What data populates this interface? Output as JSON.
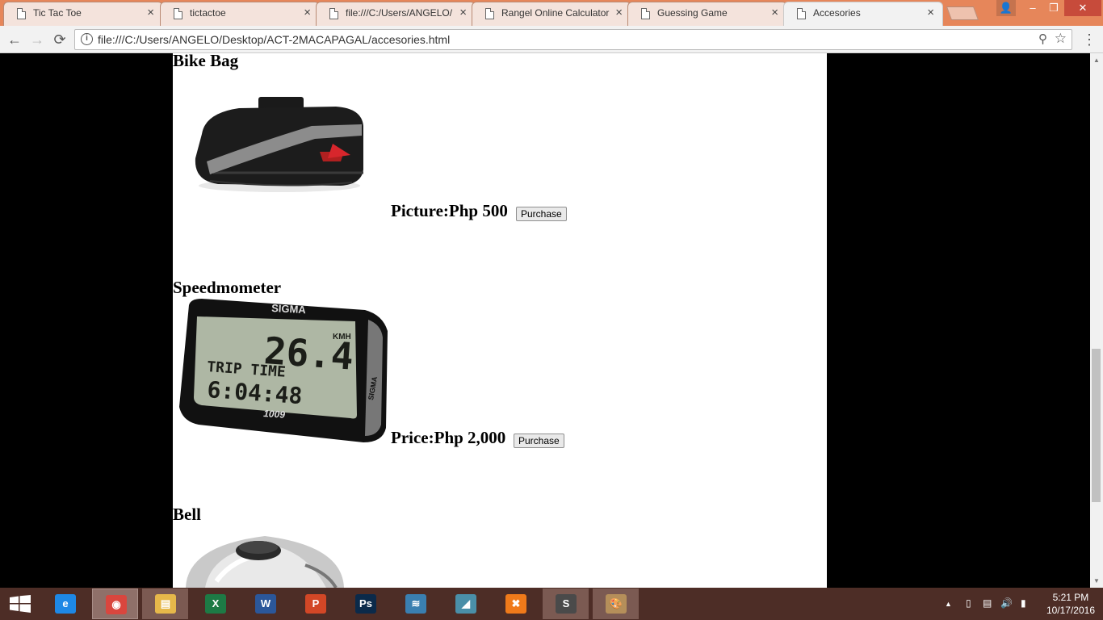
{
  "tabs": [
    {
      "title": "Tic Tac Toe"
    },
    {
      "title": "tictactoe"
    },
    {
      "title": "file:///C:/Users/ANGELO/"
    },
    {
      "title": "Rangel Online Calculator"
    },
    {
      "title": "Guessing Game"
    },
    {
      "title": "Accesories"
    }
  ],
  "tab_close": "×",
  "window": {
    "user": "👤",
    "minimize": "–",
    "restore": "❐",
    "close": "✕"
  },
  "toolbar": {
    "back": "←",
    "forward": "→",
    "reload": "⟳",
    "info": "i",
    "url": "file:///C:/Users/ANGELO/Desktop/ACT-2MACAPAGAL/accesories.html",
    "zoom": "⚲",
    "star": "☆",
    "menu": "⋮"
  },
  "products": [
    {
      "name": "Bike Bag",
      "price_label": "Picture:Php 500",
      "button": "Purchase"
    },
    {
      "name": "Speedmometer",
      "price_label": "Price:Php 2,000",
      "button": "Purchase"
    },
    {
      "name": "Bell"
    }
  ],
  "speedo": {
    "brand": "SIGMA",
    "unit": "KMH",
    "speed": "26.4",
    "trip_label": "TRIP TIME",
    "time": "6:04:48",
    "model": "1009"
  },
  "taskbar": {
    "start_icon": "windows-icon",
    "apps": [
      {
        "name": "internet-explorer-icon",
        "glyph": "e",
        "color": "#1e88e5"
      },
      {
        "name": "chrome-icon",
        "glyph": "◉",
        "color": "#d9463e"
      },
      {
        "name": "file-explorer-icon",
        "glyph": "▤",
        "color": "#e6b84a"
      },
      {
        "name": "excel-icon",
        "glyph": "X",
        "color": "#1d7a45"
      },
      {
        "name": "word-icon",
        "glyph": "W",
        "color": "#2b579a"
      },
      {
        "name": "powerpoint-icon",
        "glyph": "P",
        "color": "#d24726"
      },
      {
        "name": "photoshop-icon",
        "glyph": "Ps",
        "color": "#0b2a4a"
      },
      {
        "name": "mysql-installer-icon",
        "glyph": "≋",
        "color": "#3a7fb0"
      },
      {
        "name": "notepad-icon",
        "glyph": "◢",
        "color": "#4a8fa8"
      },
      {
        "name": "xampp-icon",
        "glyph": "✖",
        "color": "#f07a1a"
      },
      {
        "name": "sublime-text-icon",
        "glyph": "S",
        "color": "#4a4a4a"
      },
      {
        "name": "paint-icon",
        "glyph": "🎨",
        "color": "#b58f5a"
      }
    ],
    "tray": {
      "chevron": "▲",
      "battery": "▯",
      "network": "▤",
      "volume": "🔊",
      "signal": "▮"
    },
    "time": "5:21 PM",
    "date": "10/17/2016"
  }
}
